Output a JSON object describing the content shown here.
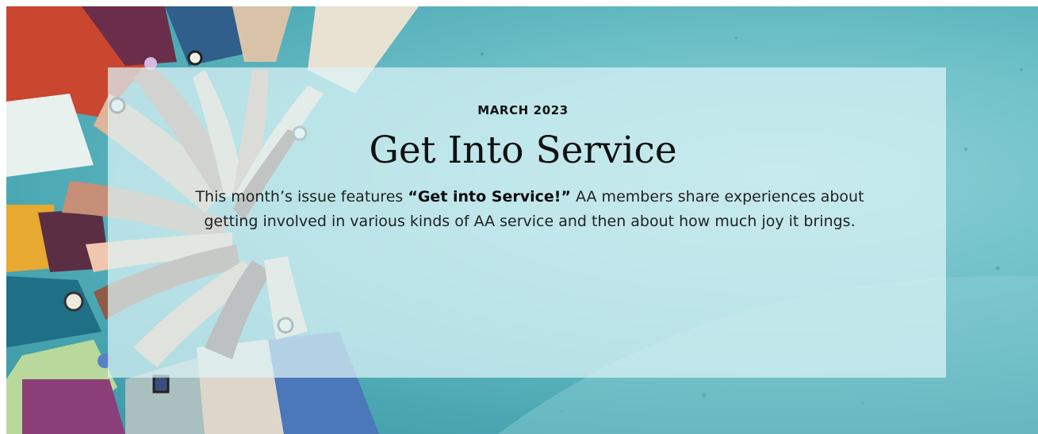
{
  "banner": {
    "eyebrow": "MARCH 2023",
    "title": "Get Into Service",
    "description": {
      "before": "This month’s issue features ",
      "highlight": "“Get into Service!”",
      "after": " AA members share experiences about getting involved in various kinds of AA service and then about how much joy it brings."
    },
    "background_art": "illustration-hands-stacked-in-circle",
    "colors": {
      "teal": "#5db5bf",
      "panel": "#dcf4f6"
    }
  }
}
